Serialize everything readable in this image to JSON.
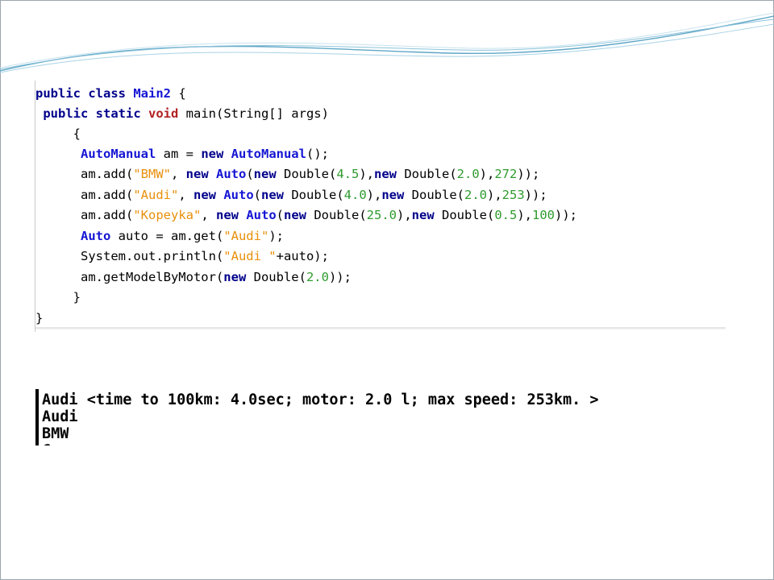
{
  "code": {
    "lines": [
      [
        {
          "t": "public class ",
          "c": "kw"
        },
        {
          "t": "Main2",
          "c": "cls"
        },
        {
          "t": " {",
          "c": "plain"
        }
      ],
      [
        {
          "t": " public static ",
          "c": "kw"
        },
        {
          "t": "void ",
          "c": "kw-red"
        },
        {
          "t": "main(String[] args)",
          "c": "plain"
        }
      ],
      [
        {
          "t": "     {",
          "c": "plain"
        }
      ],
      [
        {
          "t": "      ",
          "c": "plain"
        },
        {
          "t": "AutoManual",
          "c": "cls"
        },
        {
          "t": " am = ",
          "c": "plain"
        },
        {
          "t": "new ",
          "c": "kw"
        },
        {
          "t": "AutoManual",
          "c": "cls"
        },
        {
          "t": "();",
          "c": "plain"
        }
      ],
      [
        {
          "t": "      am.add(",
          "c": "plain"
        },
        {
          "t": "\"BMW\"",
          "c": "str"
        },
        {
          "t": ", ",
          "c": "plain"
        },
        {
          "t": "new ",
          "c": "kw"
        },
        {
          "t": "Auto",
          "c": "cls"
        },
        {
          "t": "(",
          "c": "plain"
        },
        {
          "t": "new ",
          "c": "kw"
        },
        {
          "t": "Double(",
          "c": "plain"
        },
        {
          "t": "4.5",
          "c": "num"
        },
        {
          "t": "),",
          "c": "plain"
        },
        {
          "t": "new ",
          "c": "kw"
        },
        {
          "t": "Double(",
          "c": "plain"
        },
        {
          "t": "2.0",
          "c": "num"
        },
        {
          "t": "),",
          "c": "plain"
        },
        {
          "t": "272",
          "c": "num"
        },
        {
          "t": "));",
          "c": "plain"
        }
      ],
      [
        {
          "t": "      am.add(",
          "c": "plain"
        },
        {
          "t": "\"Audi\"",
          "c": "str"
        },
        {
          "t": ", ",
          "c": "plain"
        },
        {
          "t": "new ",
          "c": "kw"
        },
        {
          "t": "Auto",
          "c": "cls"
        },
        {
          "t": "(",
          "c": "plain"
        },
        {
          "t": "new ",
          "c": "kw"
        },
        {
          "t": "Double(",
          "c": "plain"
        },
        {
          "t": "4.0",
          "c": "num"
        },
        {
          "t": "),",
          "c": "plain"
        },
        {
          "t": "new ",
          "c": "kw"
        },
        {
          "t": "Double(",
          "c": "plain"
        },
        {
          "t": "2.0",
          "c": "num"
        },
        {
          "t": "),",
          "c": "plain"
        },
        {
          "t": "253",
          "c": "num"
        },
        {
          "t": "));",
          "c": "plain"
        }
      ],
      [
        {
          "t": "      am.add(",
          "c": "plain"
        },
        {
          "t": "\"Kopeyka\"",
          "c": "str"
        },
        {
          "t": ", ",
          "c": "plain"
        },
        {
          "t": "new ",
          "c": "kw"
        },
        {
          "t": "Auto",
          "c": "cls"
        },
        {
          "t": "(",
          "c": "plain"
        },
        {
          "t": "new ",
          "c": "kw"
        },
        {
          "t": "Double(",
          "c": "plain"
        },
        {
          "t": "25.0",
          "c": "num"
        },
        {
          "t": "),",
          "c": "plain"
        },
        {
          "t": "new ",
          "c": "kw"
        },
        {
          "t": "Double(",
          "c": "plain"
        },
        {
          "t": "0.5",
          "c": "num"
        },
        {
          "t": "),",
          "c": "plain"
        },
        {
          "t": "100",
          "c": "num"
        },
        {
          "t": "));",
          "c": "plain"
        }
      ],
      [
        {
          "t": "      ",
          "c": "plain"
        },
        {
          "t": "Auto",
          "c": "cls"
        },
        {
          "t": " auto = am.get(",
          "c": "plain"
        },
        {
          "t": "\"Audi\"",
          "c": "str"
        },
        {
          "t": ");",
          "c": "plain"
        }
      ],
      [
        {
          "t": "      System.out.println(",
          "c": "plain"
        },
        {
          "t": "\"Audi \"",
          "c": "str"
        },
        {
          "t": "+auto);",
          "c": "plain"
        }
      ],
      [
        {
          "t": "      am.getModelByMotor(",
          "c": "plain"
        },
        {
          "t": "new ",
          "c": "kw"
        },
        {
          "t": "Double(",
          "c": "plain"
        },
        {
          "t": "2.0",
          "c": "num"
        },
        {
          "t": "));",
          "c": "plain"
        }
      ],
      [
        {
          "t": "     }",
          "c": "plain"
        }
      ],
      [
        {
          "t": "}",
          "c": "plain"
        }
      ]
    ]
  },
  "console": {
    "lines": [
      "Audi <time to 100km: 4.0sec; motor: 2.0 l; max speed: 253km. >",
      "Audi",
      "BMW",
      "C"
    ]
  },
  "colors": {
    "keyword": "#00008b",
    "class_name": "#1515d4",
    "void_keyword": "#b22222",
    "string": "#e8900c",
    "number": "#2f9b2f",
    "swoosh": "#5fa7c7"
  }
}
